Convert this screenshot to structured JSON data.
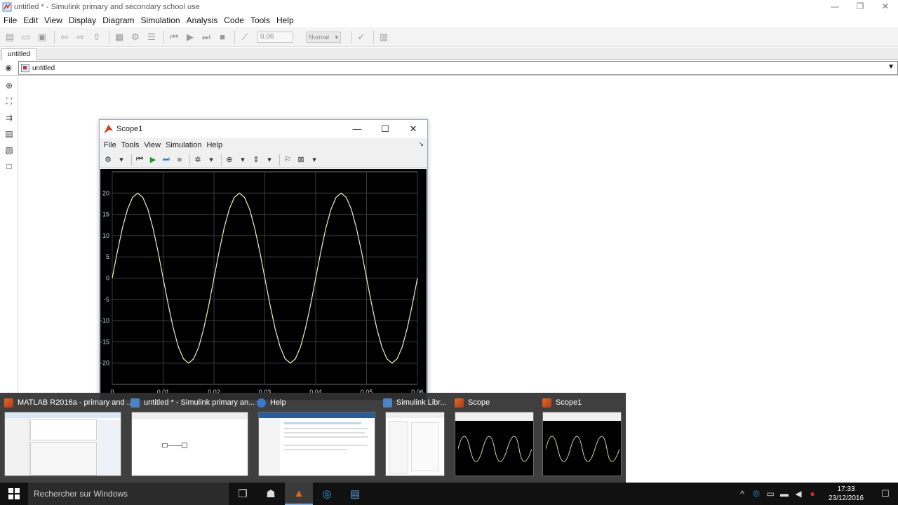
{
  "main_window": {
    "title": "untitled * - Simulink primary and secondary school use",
    "controls": {
      "minimize": "—",
      "maximize": "❐",
      "close": "✕"
    }
  },
  "menu": [
    "File",
    "Edit",
    "View",
    "Display",
    "Diagram",
    "Simulation",
    "Analysis",
    "Code",
    "Tools",
    "Help"
  ],
  "toolbar": {
    "stop_time": "0.06",
    "sim_mode": "Normal"
  },
  "tab": {
    "label": "untitled"
  },
  "address": {
    "label": "untitled"
  },
  "scope": {
    "title": "Scope1",
    "menu": [
      "File",
      "Tools",
      "View",
      "Simulation",
      "Help"
    ],
    "controls": {
      "minimize": "—",
      "maximize": "☐",
      "close": "✕"
    },
    "trace_color": "#f3f0b5",
    "grid_color": "#3d3d3d"
  },
  "chart_data": {
    "type": "line",
    "title": "",
    "xlabel": "",
    "ylabel": "",
    "xlim": [
      0,
      0.06
    ],
    "ylim": [
      -25,
      25
    ],
    "x_ticks": [
      0,
      0.01,
      0.02,
      0.03,
      0.04,
      0.05,
      0.06
    ],
    "x_tick_labels": [
      "0",
      "0.01",
      "0.02",
      "0.03",
      "0.04",
      "0.05",
      "0.06"
    ],
    "y_ticks": [
      20,
      15,
      10,
      5,
      0,
      -5,
      -10,
      -15,
      -20
    ],
    "y_tick_labels": [
      "20",
      "15",
      "10",
      "5",
      "0",
      "-5",
      "-10",
      "-15",
      "-20"
    ],
    "grid": true,
    "series": [
      {
        "x": [
          0,
          0.001,
          0.002,
          0.003,
          0.004,
          0.005,
          0.006,
          0.007,
          0.008,
          0.009,
          0.01,
          0.011,
          0.012,
          0.013,
          0.014,
          0.015,
          0.016,
          0.017,
          0.018,
          0.019,
          0.02,
          0.021,
          0.022,
          0.023,
          0.024,
          0.025,
          0.026,
          0.027,
          0.028,
          0.029,
          0.03,
          0.031,
          0.032,
          0.033,
          0.034,
          0.035,
          0.036,
          0.037,
          0.038,
          0.039,
          0.04,
          0.041,
          0.042,
          0.043,
          0.044,
          0.045,
          0.046,
          0.047,
          0.048,
          0.049,
          0.05,
          0.051,
          0.052,
          0.053,
          0.054,
          0.055,
          0.056,
          0.057,
          0.058,
          0.059,
          0.06
        ],
        "values": [
          0,
          6.2,
          11.8,
          16.2,
          19.0,
          20.0,
          19.0,
          16.2,
          11.8,
          6.2,
          0,
          -6.2,
          -11.8,
          -16.2,
          -19.0,
          -20.0,
          -19.0,
          -16.2,
          -11.8,
          -6.2,
          0,
          6.2,
          11.8,
          16.2,
          19.0,
          20.0,
          19.0,
          16.2,
          11.8,
          6.2,
          0,
          -6.2,
          -11.8,
          -16.2,
          -19.0,
          -20.0,
          -19.0,
          -16.2,
          -11.8,
          -6.2,
          0,
          6.2,
          11.8,
          16.2,
          19.0,
          20.0,
          19.0,
          16.2,
          11.8,
          6.2,
          0,
          -6.2,
          -11.8,
          -16.2,
          -19.0,
          -20.0,
          -19.0,
          -16.2,
          -11.8,
          -6.2,
          0
        ]
      }
    ]
  },
  "previews": [
    {
      "title": "MATLAB R2016a - primary and ...",
      "icon": "matlab-icon",
      "icon_color": "#e06a1f"
    },
    {
      "title": "untitled * - Simulink primary an...",
      "icon": "simulink-icon",
      "icon_color": "#4a84c4"
    },
    {
      "title": "Help",
      "icon": "help-icon",
      "icon_color": "#3b78c9"
    },
    {
      "title": "Simulink Libr...",
      "icon": "simulink-library-icon",
      "icon_color": "#4a84c4"
    },
    {
      "title": "Scope",
      "icon": "matlab-icon",
      "icon_color": "#e06a1f"
    },
    {
      "title": "Scope1",
      "icon": "matlab-icon",
      "icon_color": "#e06a1f"
    }
  ],
  "taskbar": {
    "search_placeholder": "Rechercher sur Windows",
    "time": "17:33",
    "date": "23/12/2016"
  }
}
